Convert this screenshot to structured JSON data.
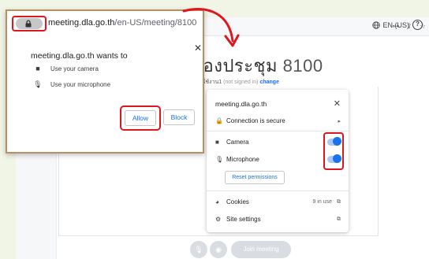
{
  "popup": {
    "url_host": "meeting.dla.go.th",
    "url_path": "/en-US/meeting/8100",
    "title": "meeting.dla.go.th wants to",
    "close": "✕",
    "permissions": [
      {
        "icon": "camera-icon",
        "label": "Use your camera"
      },
      {
        "icon": "microphone-icon",
        "label": "Use your microphone"
      }
    ],
    "allow_label": "Allow",
    "block_label": "Block"
  },
  "page": {
    "language": "EN (US)",
    "help": "?",
    "room_title_prefix": "้องประชุม",
    "room_number": "8100",
    "user_name": "ใช้งาน1",
    "user_status": "(not signed in)",
    "change_link": "change",
    "join_label": "Join meeting"
  },
  "site_info": {
    "host": "meeting.dla.go.th",
    "close": "✕",
    "connection": "Connection is secure",
    "camera_label": "Camera",
    "camera_on": true,
    "microphone_label": "Microphone",
    "microphone_on": true,
    "reset_label": "Reset permissions",
    "cookies_label": "Cookies",
    "cookies_count": "9 in use",
    "site_settings_label": "Site settings"
  },
  "colors": {
    "highlight": "#e0161e",
    "accent": "#1a73e8",
    "frame": "#b89066",
    "backdrop": "#f1f5e6"
  }
}
